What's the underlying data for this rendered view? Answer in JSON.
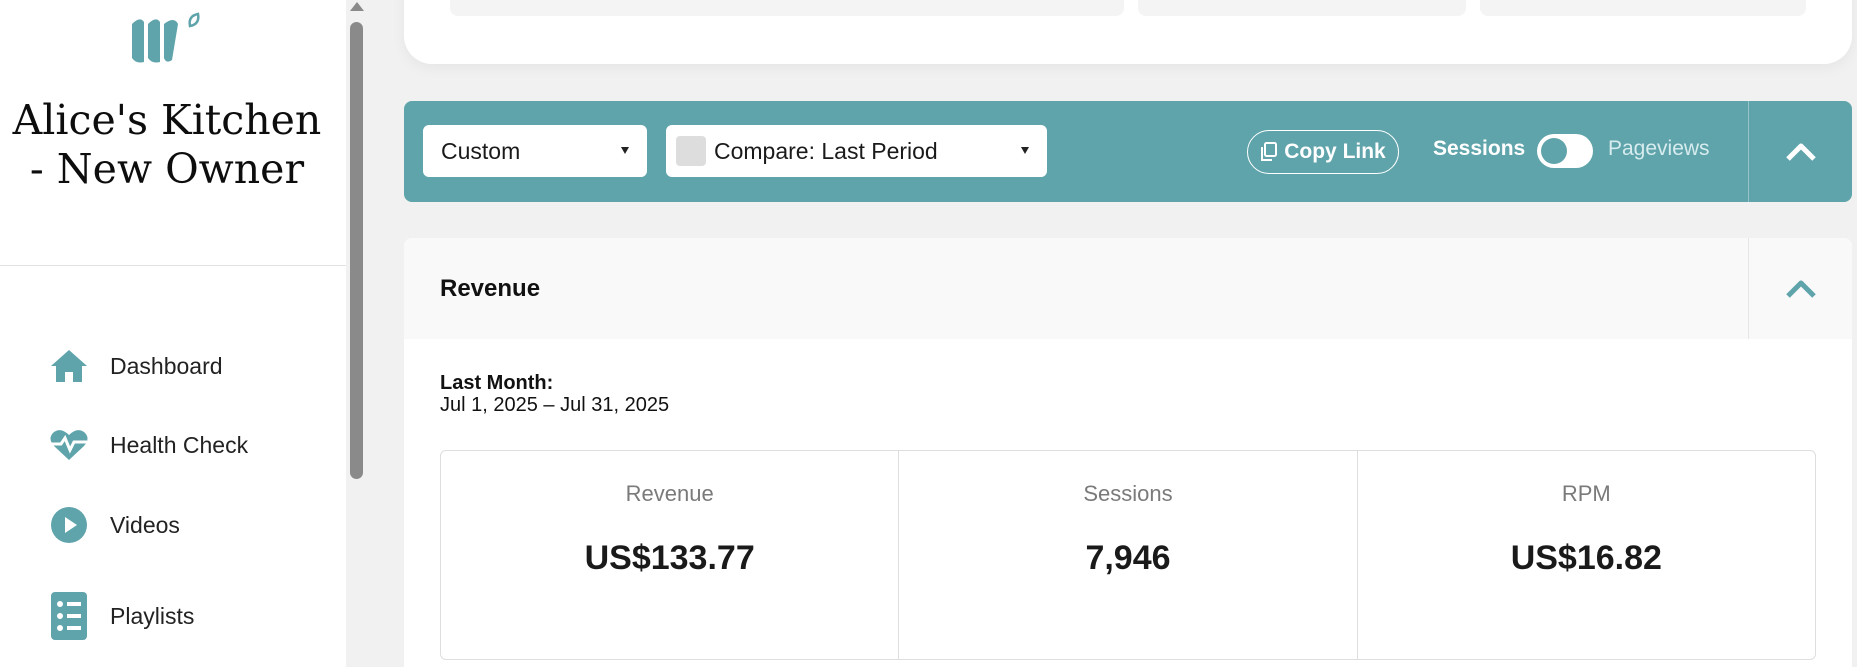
{
  "sidebar": {
    "site_title": "Alice's Kitchen - New Owner",
    "items": [
      {
        "label": "Dashboard",
        "icon": "home-icon"
      },
      {
        "label": "Health Check",
        "icon": "heartbeat-icon"
      },
      {
        "label": "Videos",
        "icon": "play-icon"
      },
      {
        "label": "Playlists",
        "icon": "list-icon"
      }
    ]
  },
  "toolbar": {
    "range_select": "Custom",
    "compare_select": "Compare: Last Period",
    "copy_link_label": "Copy Link",
    "toggle_left_label": "Sessions",
    "toggle_right_label": "Pageviews"
  },
  "revenue": {
    "title": "Revenue",
    "period_label": "Last Month:",
    "period_range": "Jul 1, 2025 – Jul 31, 2025",
    "stats": [
      {
        "label": "Revenue",
        "value": "US$133.77"
      },
      {
        "label": "Sessions",
        "value": "7,946"
      },
      {
        "label": "RPM",
        "value": "US$16.82"
      }
    ]
  },
  "colors": {
    "accent": "#5fa4ab",
    "background": "#f1f1f1",
    "card": "#ffffff"
  }
}
